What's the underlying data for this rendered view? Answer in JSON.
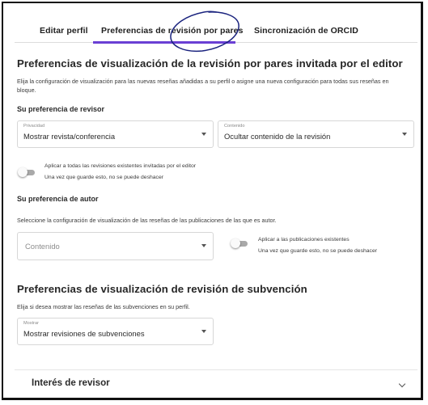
{
  "tabs": [
    {
      "label": "Editar perfil"
    },
    {
      "label": "Preferencias de revisión por pares"
    },
    {
      "label": "Sincronización de ORCID"
    }
  ],
  "colors": {
    "accent": "#6a3fd4",
    "annotation": "#1a237e"
  },
  "editor_section": {
    "title": "Preferencias de visualización de la revisión por pares invitada por el editor",
    "description": "Elija la configuración de visualización para las nuevas reseñas añadidas a su perfil o asigne una nueva configuración para todas sus reseñas en bloque.",
    "reviewer_heading": "Su preferencia de revisor",
    "privacy_select": {
      "label": "Privacidad",
      "value": "Mostrar revista/conferencia"
    },
    "content_select": {
      "label": "Contenido",
      "value": "Ocultar contenido de la revisión"
    },
    "apply_toggle": {
      "line1": "Aplicar a todas las revisiones existentes invitadas por el editor",
      "line2": "Una vez que guarde esto, no se puede deshacer"
    }
  },
  "author_section": {
    "heading": "Su preferencia de autor",
    "description": "Seleccione la configuración de visualización de las reseñas de las publicaciones de las que es autor.",
    "content_select": {
      "placeholder": "Contenido"
    },
    "apply_toggle": {
      "line1": "Aplicar a las publicaciones existentes",
      "line2": "Una vez que guarde esto, no se puede deshacer"
    }
  },
  "grant_section": {
    "title": "Preferencias de visualización de revisión de subvención",
    "description": "Elija si desea mostrar las reseñas de las subvenciones en su perfil.",
    "show_select": {
      "label": "Mostrar",
      "value": "Mostrar revisiones de subvenciones"
    }
  },
  "accordion": {
    "title": "Interés de revisor"
  }
}
